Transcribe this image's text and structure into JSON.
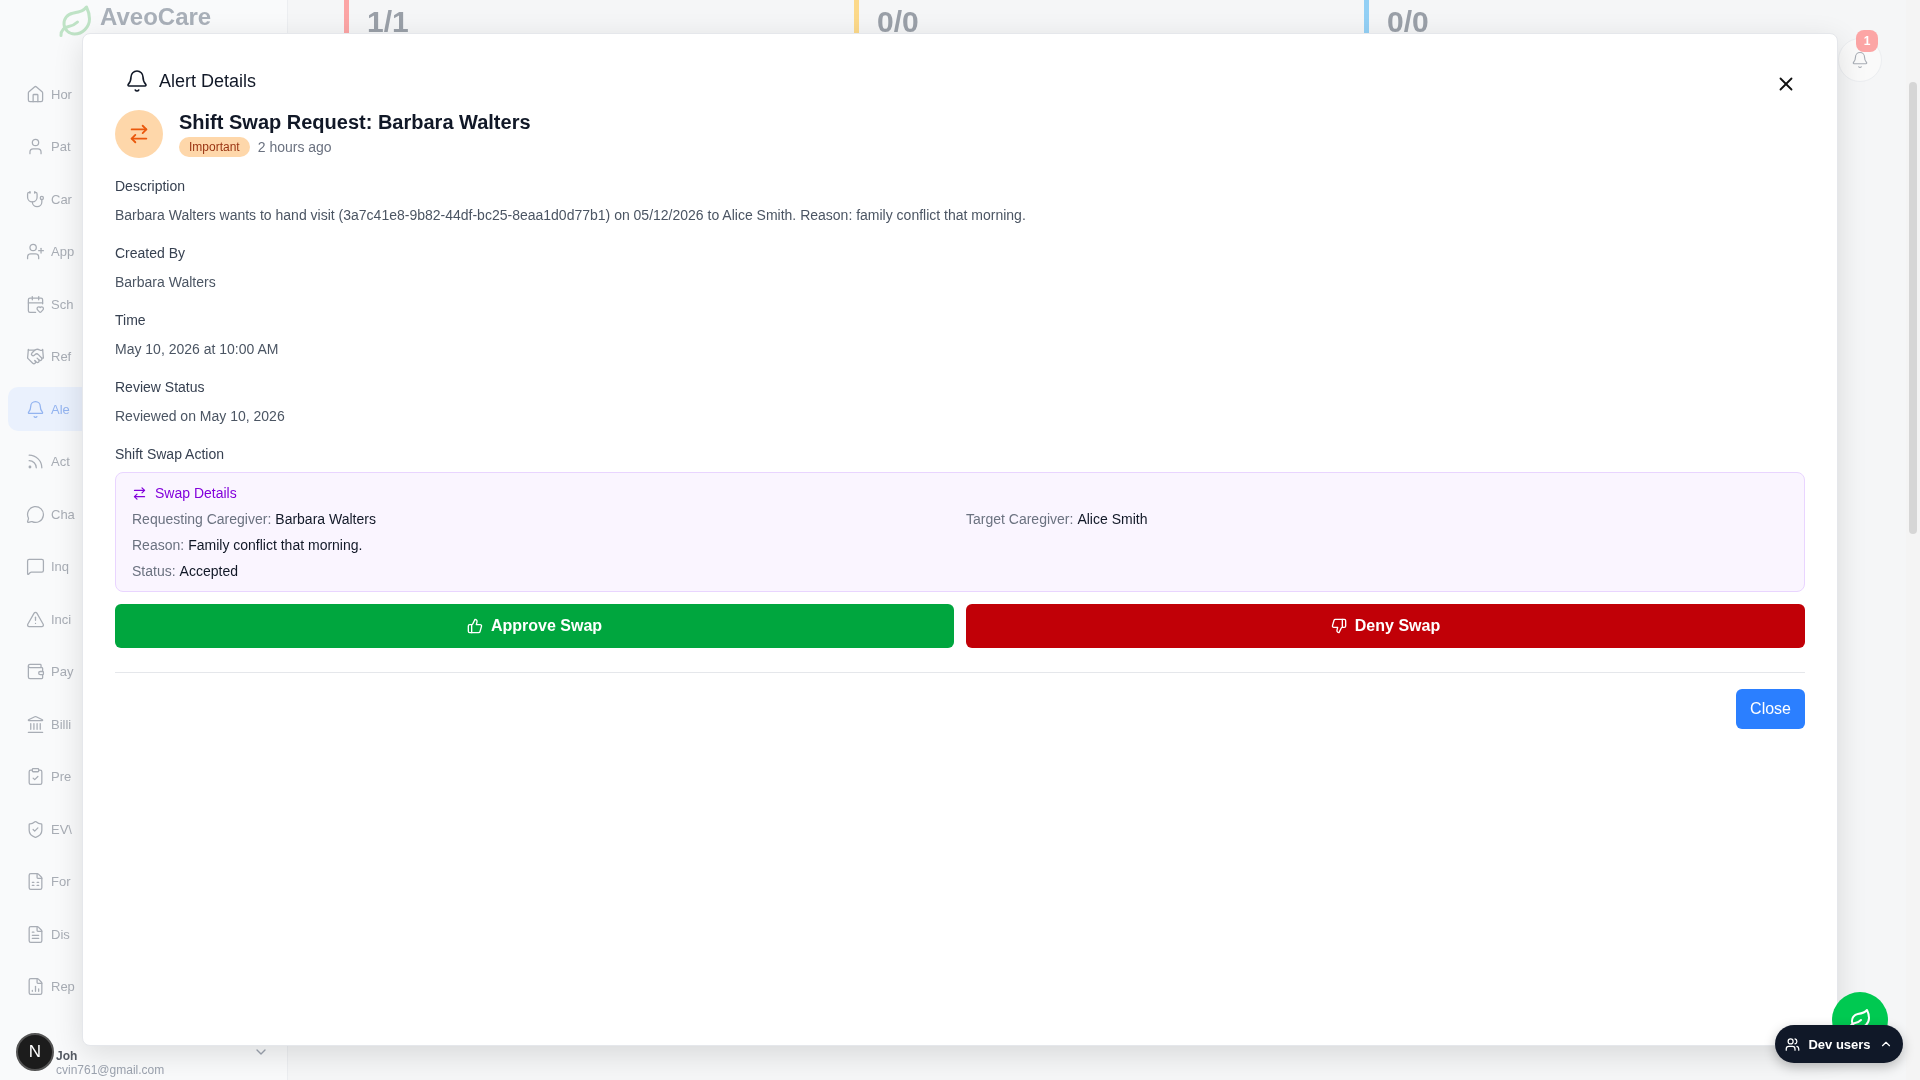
{
  "sidebar": {
    "logo": "AveoCare",
    "items": [
      {
        "label": "Hor",
        "selected": false
      },
      {
        "label": "Pat",
        "selected": false
      },
      {
        "label": "Car",
        "selected": false
      },
      {
        "label": "App",
        "selected": false
      },
      {
        "label": "Sch",
        "selected": false
      },
      {
        "label": "Ref",
        "selected": false
      },
      {
        "label": "Ale",
        "selected": true
      },
      {
        "label": "Act",
        "selected": false
      },
      {
        "label": "Cha",
        "selected": false
      },
      {
        "label": "Inq",
        "selected": false
      },
      {
        "label": "Inci",
        "selected": false
      },
      {
        "label": "Pay",
        "selected": false
      },
      {
        "label": "Billi",
        "selected": false
      },
      {
        "label": "Pre",
        "selected": false
      },
      {
        "label": "EV\\",
        "selected": false
      },
      {
        "label": "For",
        "selected": false
      },
      {
        "label": "Dis",
        "selected": false
      },
      {
        "label": "Rep",
        "selected": false
      }
    ],
    "user": {
      "avatar": "N",
      "name": "Joh",
      "email": "cvin761@gmail.com"
    }
  },
  "stats": [
    {
      "value": "1/1",
      "color": "#fca5a5"
    },
    {
      "value": "0/0",
      "color": "#fcd98a"
    },
    {
      "value": "0/0",
      "color": "#93d0f5"
    }
  ],
  "notifications": {
    "count": "1"
  },
  "modal": {
    "title": "Alert Details",
    "alert": {
      "title": "Shift Swap Request: Barbara Walters",
      "priority": "Important",
      "time": "2 hours ago"
    },
    "sections": [
      {
        "label": "Description",
        "value": "Barbara Walters wants to hand visit (3a7c41e8-9b82-44df-bc25-8eaa1d0d77b1) on 05/12/2026 to Alice Smith. Reason: family conflict that morning."
      },
      {
        "label": "Created By",
        "value": "Barbara Walters"
      },
      {
        "label": "Time",
        "value": "May 10, 2026 at 10:00 AM"
      },
      {
        "label": "Review Status",
        "value": "Reviewed on May 10, 2026"
      }
    ],
    "swap": {
      "label": "Shift Swap Action",
      "heading": "Swap Details",
      "rows": [
        [
          {
            "label": "Requesting Caregiver:",
            "value": "Barbara Walters"
          },
          {
            "label": "Target Caregiver:",
            "value": "Alice Smith"
          }
        ],
        [
          {
            "label": "Reason:",
            "value": "Family conflict that morning."
          }
        ],
        [
          {
            "label": "Status:",
            "value": "Accepted"
          }
        ]
      ]
    },
    "actions": [
      {
        "label": "Approve Swap",
        "kind": "approve"
      },
      {
        "label": "Deny Swap",
        "kind": "deny"
      }
    ],
    "close": "Close"
  },
  "dev_users": {
    "label": "Dev users"
  }
}
